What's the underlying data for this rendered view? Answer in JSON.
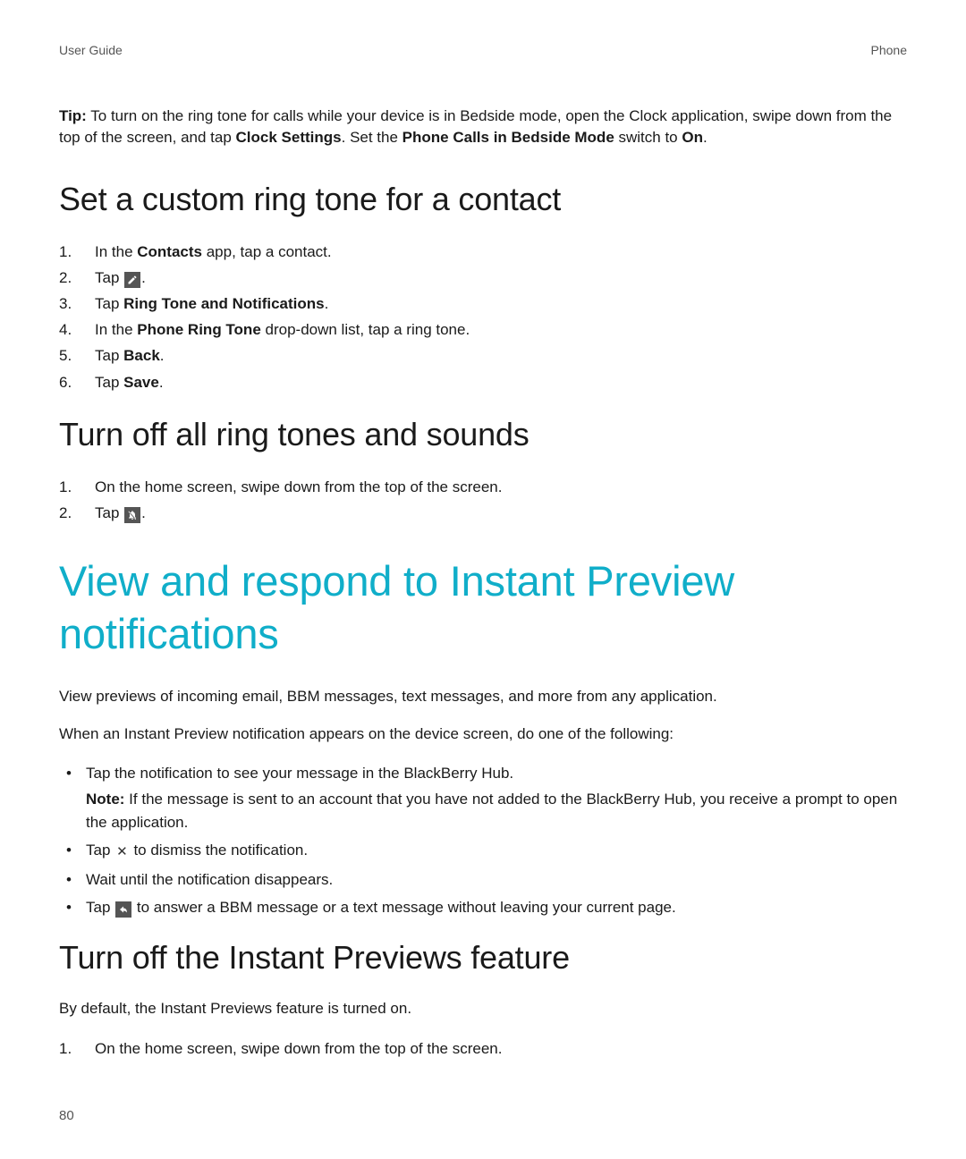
{
  "header": {
    "left": "User Guide",
    "right": "Phone"
  },
  "tip": {
    "label": "Tip:",
    "text_part1": " To turn on the ring tone for calls while your device is in Bedside mode, open the Clock application, swipe down from the top of the screen, and tap ",
    "bold1": "Clock Settings",
    "text_part2": ". Set the ",
    "bold2": "Phone Calls in Bedside Mode",
    "text_part3": " switch to ",
    "bold3": "On",
    "text_part4": "."
  },
  "section1": {
    "title": "Set a custom ring tone for a contact",
    "steps": {
      "s1_pre": "In the ",
      "s1_bold": "Contacts",
      "s1_post": " app, tap a contact.",
      "s2_pre": "Tap ",
      "s2_post": ".",
      "s3_pre": "Tap ",
      "s3_bold": "Ring Tone and Notifications",
      "s3_post": ".",
      "s4_pre": "In the ",
      "s4_bold": "Phone Ring Tone",
      "s4_post": " drop-down list, tap a ring tone.",
      "s5_pre": "Tap ",
      "s5_bold": "Back",
      "s5_post": ".",
      "s6_pre": "Tap ",
      "s6_bold": "Save",
      "s6_post": "."
    }
  },
  "section2": {
    "title": "Turn off all ring tones and sounds",
    "steps": {
      "s1": "On the home screen, swipe down from the top of the screen.",
      "s2_pre": "Tap ",
      "s2_post": "."
    }
  },
  "chapter": "View and respond to Instant Preview notifications",
  "chapter_p1": "View previews of incoming email, BBM messages, text messages, and more from any application.",
  "chapter_p2": "When an Instant Preview notification appears on the device screen, do one of the following:",
  "bullets": {
    "b1": "Tap the notification to see your message in the BlackBerry Hub.",
    "b1_note_label": "Note:",
    "b1_note_text": " If the message is sent to an account that you have not added to the BlackBerry Hub, you receive a prompt to open the application.",
    "b2_pre": "Tap ",
    "b2_post": " to dismiss the notification.",
    "b3": "Wait until the notification disappears.",
    "b4_pre": "Tap ",
    "b4_post": " to answer a BBM message or a text message without leaving your current page."
  },
  "section3": {
    "title": "Turn off the Instant Previews feature",
    "p1": "By default, the Instant Previews feature is turned on.",
    "steps": {
      "s1": "On the home screen, swipe down from the top of the screen."
    }
  },
  "page_number": "80"
}
